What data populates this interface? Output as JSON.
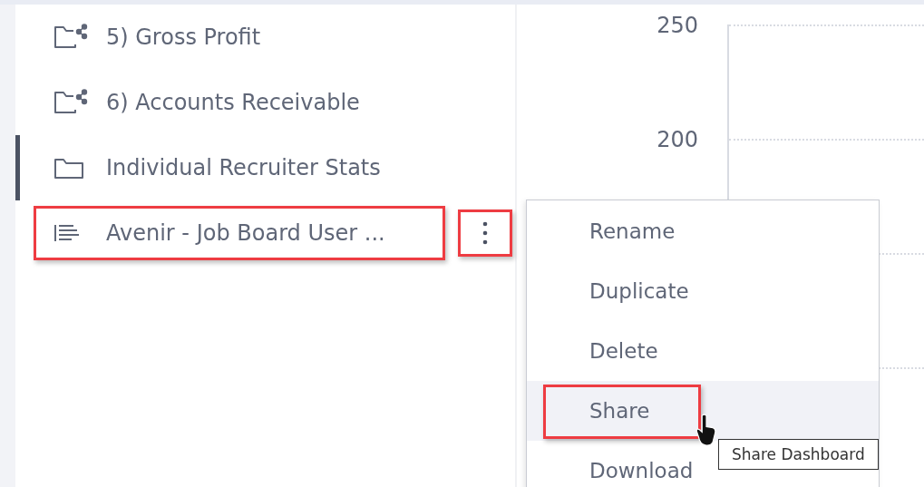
{
  "sidebar": {
    "items": [
      {
        "kind": "shared-folder",
        "label": "5) Gross Profit",
        "selected": false,
        "highlighted": false
      },
      {
        "kind": "shared-folder",
        "label": "6) Accounts Receivable",
        "selected": false,
        "highlighted": false
      },
      {
        "kind": "folder",
        "label": "Individual Recruiter Stats",
        "selected": true,
        "highlighted": false
      },
      {
        "kind": "report",
        "label": "Avenir - Job Board User ...",
        "selected": false,
        "highlighted": true,
        "more_highlighted": true
      }
    ]
  },
  "chart": {
    "y_labels": [
      "250",
      "200"
    ]
  },
  "context_menu": {
    "items": [
      {
        "label": "Rename",
        "hovered": false,
        "highlighted": false
      },
      {
        "label": "Duplicate",
        "hovered": false,
        "highlighted": false
      },
      {
        "label": "Delete",
        "hovered": false,
        "highlighted": false
      },
      {
        "label": "Share",
        "hovered": true,
        "highlighted": true
      },
      {
        "label": "Download",
        "hovered": false,
        "highlighted": false
      }
    ]
  },
  "tooltip": {
    "text": "Share Dashboard"
  }
}
